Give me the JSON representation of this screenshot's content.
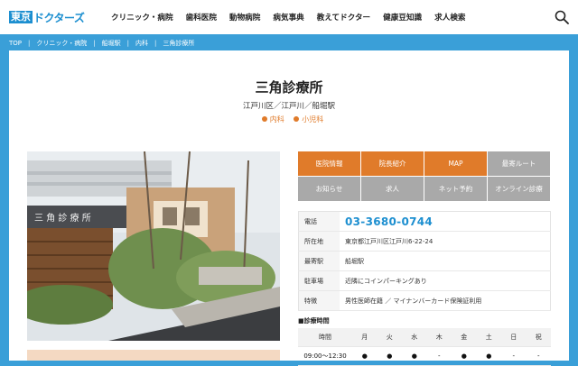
{
  "brand": {
    "logo_block1": "東京",
    "logo_block2": "",
    "logo_text": "ドクターズ"
  },
  "nav": [
    "クリニック・病院",
    "歯科医院",
    "動物病院",
    "病気事典",
    "教えてドクター",
    "健康豆知識",
    "求人検索"
  ],
  "breadcrumb": [
    "TOP",
    "クリニック・病院",
    "船堀駅",
    "内科",
    "三角診療所"
  ],
  "clinic": {
    "name": "三角診療所",
    "location": "江戸川区／江戸川／船堀駅",
    "departments": [
      "内科",
      "小児科"
    ]
  },
  "menu": [
    {
      "label": "医院情報",
      "style": "orange"
    },
    {
      "label": "院長紹介",
      "style": "orange"
    },
    {
      "label": "MAP",
      "style": "orange"
    },
    {
      "label": "最寄ルート",
      "style": "gray"
    },
    {
      "label": "お知らせ",
      "style": "gray"
    },
    {
      "label": "求人",
      "style": "gray"
    },
    {
      "label": "ネット予約",
      "style": "gray"
    },
    {
      "label": "オンライン診療",
      "style": "gray"
    }
  ],
  "info": [
    {
      "label": "電話",
      "value": "03-3680-0744"
    },
    {
      "label": "所在地",
      "value": "東京都江戸川区江戸川6-22-24"
    },
    {
      "label": "最寄駅",
      "value": "船堀駅"
    },
    {
      "label": "駐車場",
      "value": "近隣にコインパーキングあり"
    },
    {
      "label": "特徴",
      "value": "男性医師在籍 ／ マイナンバーカード保険証利用"
    }
  ],
  "schedule": {
    "title": "■診療時間",
    "headers": [
      "時間",
      "月",
      "火",
      "水",
      "木",
      "金",
      "土",
      "日",
      "祝"
    ],
    "rows": [
      [
        "09:00～12:30",
        "●",
        "●",
        "●",
        "-",
        "●",
        "●",
        "-",
        "-"
      ]
    ]
  },
  "photo_sign": "三 角 診 療 所",
  "colors": {
    "accent": "#3a9fd8",
    "orange": "#e07b2a",
    "gray": "#a9a9a9",
    "brand": "#1d8fd0"
  }
}
